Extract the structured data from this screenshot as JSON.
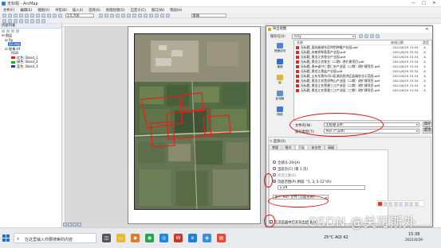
{
  "app": {
    "title": "无标题 - ArcMap",
    "menus": [
      "文件(F)",
      "编辑(E)",
      "视图(V)",
      "书签(B)",
      "插入(I)",
      "选择(S)",
      "地理处理(G)",
      "自定义(C)",
      "窗口(W)",
      "帮助(H)"
    ],
    "scale": "1:5,700",
    "layer_select": "影像",
    "window_controls": [
      "—",
      "□",
      "✕"
    ]
  },
  "toc": {
    "title": "内容列表",
    "layers": [
      {
        "label": "图层",
        "indent": 0
      },
      {
        "label": "Ry",
        "indent": 1
      },
      {
        "label": "11.shp",
        "indent": 2
      },
      {
        "label": "影像.tif",
        "indent": 1
      },
      {
        "label": "RGB",
        "indent": 2
      },
      {
        "label": "红色: Band_1",
        "indent": 2,
        "color": "#e02020"
      },
      {
        "label": "绿色: Band_2",
        "indent": 2,
        "color": "#18a818"
      },
      {
        "label": "蓝色: Band_3",
        "indent": 2,
        "color": "#2038d8"
      }
    ]
  },
  "dialog": {
    "title": "导出地图",
    "close": "✕",
    "save_in_label": "保存在(I):",
    "save_in_value": "Tccy",
    "places": [
      "快速访问",
      "桌面",
      "库",
      "此电脑",
      "网络"
    ],
    "columns": [
      "名称",
      "修改日期",
      "类型"
    ],
    "files": [
      {
        "name": "无标题_面向嵌湖东区特色种植产业园.pdf",
        "date": "2021/6/29 15:34",
        "type": "A"
      },
      {
        "name": "无标题_苏南伊犁葡萄产业园.pdf",
        "date": "2021/6/29 15:34",
        "type": "A"
      },
      {
        "name": "无标题_黑龙江农牧业产业园.pdf",
        "date": "2021/6/29 15:34",
        "type": "A"
      },
      {
        "name": "无标题_黑龙江农牧业（二期）改扩建项目.pdf",
        "date": "2021/6/29 15:34",
        "type": "A"
      },
      {
        "name": "无标题_贵州省兴仁薏仁米产业园（二期）改扩建项目.pdf",
        "date": "2021/6/29 15:34",
        "type": "A"
      },
      {
        "name": "无标题_黑龙江黑盐产业园.pdf",
        "date": "2021/6/29 15:34",
        "type": "A"
      },
      {
        "name": "无标题_山东东营市河口区湖北经济区盐碱农业示范园.pdf",
        "date": "2021/6/29 15:34",
        "type": "A"
      },
      {
        "name": "无标题_黑龙江农垦双鸭山产业园（二期）改扩建项目.pdf",
        "date": "2021/6/29 15:34",
        "type": "A"
      },
      {
        "name": "无标题_黑龙江农垦建三江产业园（二期）改扩建项目.pdf",
        "date": "2021/6/29 15:34",
        "type": "A"
      },
      {
        "name": "无标题_黑龙江农垦建三江产业园（三期）改扩建项目.pdf",
        "date": "2021/6/29 15:34",
        "type": "A"
      }
    ],
    "filename_label": "文件名(N):",
    "filename_value": "无标题.pdf",
    "filetype_label": "保存类型(T):",
    "filetype_value": "PDF (*.pdf)",
    "save_button": "保存(S)",
    "cancel_button": "取消",
    "options_toggle": "▽ 选项(O)",
    "tabs": [
      "常规",
      "格式",
      "页面",
      "安全性",
      "高级"
    ],
    "page_range_all": "全部(1-29)(A)",
    "page_range_current": "当前页(C)  (第 1 页)",
    "page_selected_elements": "所选元素(E)",
    "page_range_pages": "页面范围(P)  例如: \"1, 3, 5-12\"(R):",
    "page_range_value": "1-29",
    "export_pages_as": "多个 PDF 文件 (页面名称)",
    "checkbox_label": "在浏览器中打开导出结果(H)"
  },
  "taskbar": {
    "search_placeholder": "在这里输入你要搜索的内容",
    "weather": "25°C AQI 42",
    "time": "15:38",
    "date": "2021/6/29",
    "watermark": "CSDN @关可斯外"
  },
  "colors": {
    "annotation_red": "#e10e0e",
    "selection_blue": "#3a78d4",
    "pdf_red": "#d62b2b"
  }
}
